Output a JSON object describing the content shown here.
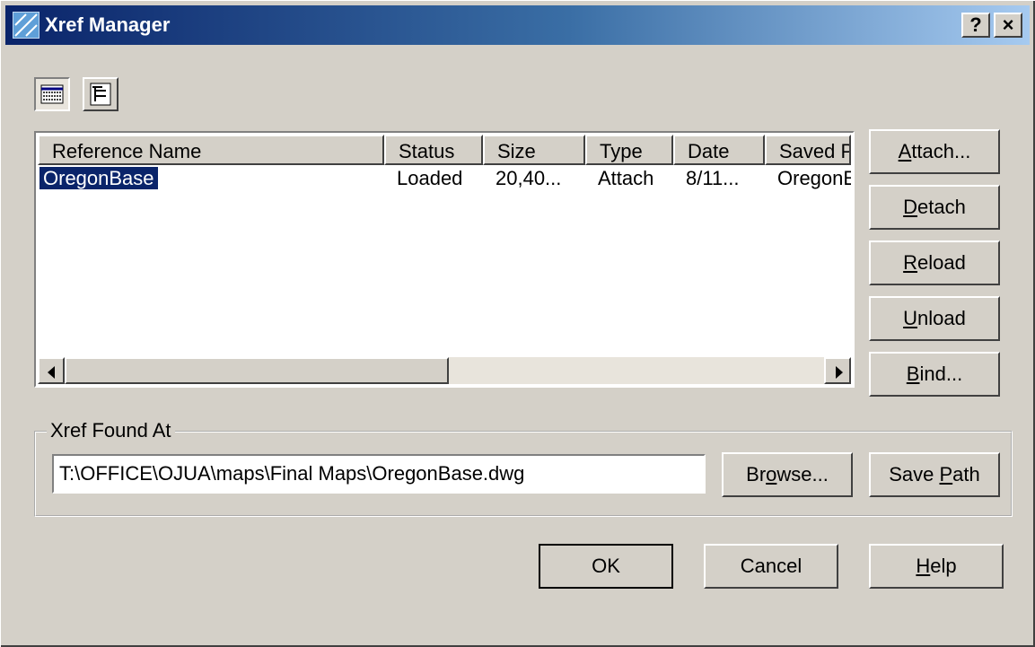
{
  "window": {
    "title": "Xref Manager",
    "help_button": "?",
    "close_button": "×"
  },
  "view_toggle": {
    "list_view_icon": "list-view-icon",
    "tree_view_icon": "tree-view-icon"
  },
  "list": {
    "columns": [
      "Reference Name",
      "Status",
      "Size",
      "Type",
      "Date",
      "Saved P"
    ],
    "rows": [
      [
        "OregonBase",
        "Loaded",
        "20,40...",
        "Attach",
        "8/11...",
        "OregonE"
      ]
    ]
  },
  "side_buttons": {
    "attach": {
      "pre": "",
      "ul": "A",
      "post": "ttach..."
    },
    "detach": {
      "pre": "",
      "ul": "D",
      "post": "etach"
    },
    "reload": {
      "pre": "",
      "ul": "R",
      "post": "eload"
    },
    "unload": {
      "pre": "",
      "ul": "U",
      "post": "nload"
    },
    "bind": {
      "pre": "",
      "ul": "B",
      "post": "ind..."
    }
  },
  "found_at": {
    "label": "Xref Found At",
    "path": "T:\\OFFICE\\OJUA\\maps\\Final Maps\\OregonBase.dwg",
    "browse": {
      "pre": "Br",
      "ul": "o",
      "post": "wse..."
    },
    "save_path": {
      "pre": "Save ",
      "ul": "P",
      "post": "ath"
    }
  },
  "footer": {
    "ok": "OK",
    "cancel": "Cancel",
    "help": {
      "pre": "",
      "ul": "H",
      "post": "elp"
    }
  },
  "colors": {
    "face": "#d4d0c8",
    "title_start": "#0a246a",
    "title_end": "#a6caf0",
    "selection": "#0a246a"
  }
}
